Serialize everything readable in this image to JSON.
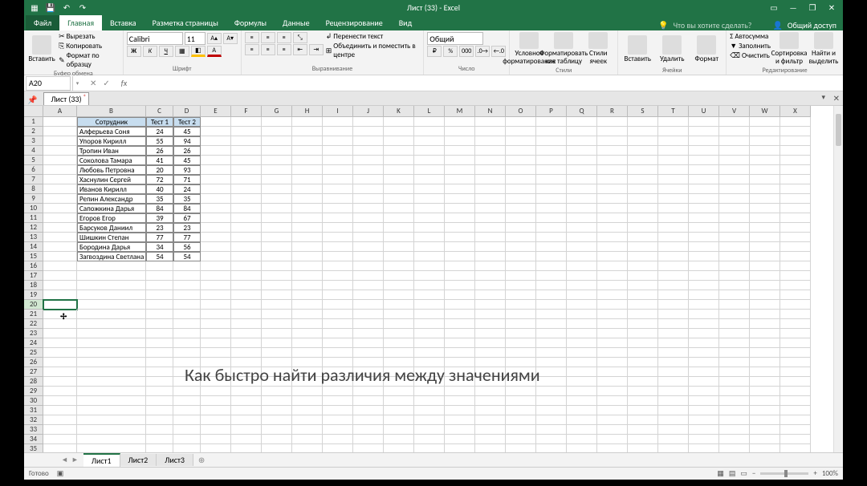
{
  "app": {
    "title": "Лист (33) - Excel",
    "share_label": "Общий доступ"
  },
  "menu": {
    "file": "Файл",
    "tabs": [
      "Главная",
      "Вставка",
      "Разметка страницы",
      "Формулы",
      "Данные",
      "Рецензирование",
      "Вид"
    ],
    "active_tab_index": 0,
    "tell_me": "Что вы хотите сделать?"
  },
  "ribbon": {
    "clipboard": {
      "paste": "Вставить",
      "cut": "Вырезать",
      "copy": "Копировать",
      "format_painter": "Формат по образцу",
      "label": "Буфер обмена"
    },
    "font": {
      "name": "Calibri",
      "size": "11",
      "label": "Шрифт"
    },
    "alignment": {
      "wrap": "Перенести текст",
      "merge": "Объединить и поместить в центре",
      "label": "Выравнивание"
    },
    "number": {
      "format": "Общий",
      "label": "Число"
    },
    "styles": {
      "cond": "Условное форматирование",
      "table": "Форматировать как таблицу",
      "cell": "Стили ячеек",
      "label": "Стили"
    },
    "cells": {
      "insert": "Вставить",
      "delete": "Удалить",
      "format": "Формат",
      "label": "Ячейки"
    },
    "editing": {
      "autosum": "Автосумма",
      "fill": "Заполнить",
      "clear": "Очистить",
      "sort": "Сортировка и фильтр",
      "find": "Найти и выделить",
      "label": "Редактирование"
    }
  },
  "name_box": "A20",
  "workbook_tab": "Лист (33)",
  "columns": [
    "A",
    "B",
    "C",
    "D",
    "E",
    "F",
    "G",
    "H",
    "I",
    "J",
    "K",
    "L",
    "M",
    "N",
    "O",
    "P",
    "Q",
    "R",
    "S",
    "T",
    "U",
    "V",
    "W",
    "X"
  ],
  "table": {
    "headers": [
      "Сотрудник",
      "Тест 1",
      "Тест 2"
    ],
    "rows": [
      [
        "Алферьева Соня",
        "24",
        "45"
      ],
      [
        "Упоров Кирилл",
        "55",
        "94"
      ],
      [
        "Тропин Иван",
        "26",
        "26"
      ],
      [
        "Соколова Тамара",
        "41",
        "45"
      ],
      [
        "Любовь Петровна",
        "20",
        "93"
      ],
      [
        "Хаснулин Сергей",
        "72",
        "71"
      ],
      [
        "Иванов Кирилл",
        "40",
        "24"
      ],
      [
        "Репин Александр",
        "35",
        "35"
      ],
      [
        "Сапожкина Дарья",
        "84",
        "84"
      ],
      [
        "Егоров Егор",
        "39",
        "67"
      ],
      [
        "Барсуков Даниил",
        "23",
        "23"
      ],
      [
        "Шишкин Степан",
        "77",
        "77"
      ],
      [
        "Бородина Дарья",
        "34",
        "56"
      ],
      [
        "Загвоздина Светлана",
        "54",
        "54"
      ]
    ]
  },
  "selected_cell": "A20",
  "overlay_text": "Как быстро найти различия между значениями",
  "sheets": {
    "tabs": [
      "Лист1",
      "Лист2",
      "Лист3"
    ],
    "active_index": 0
  },
  "status": {
    "ready": "Готово",
    "zoom": "100%"
  }
}
